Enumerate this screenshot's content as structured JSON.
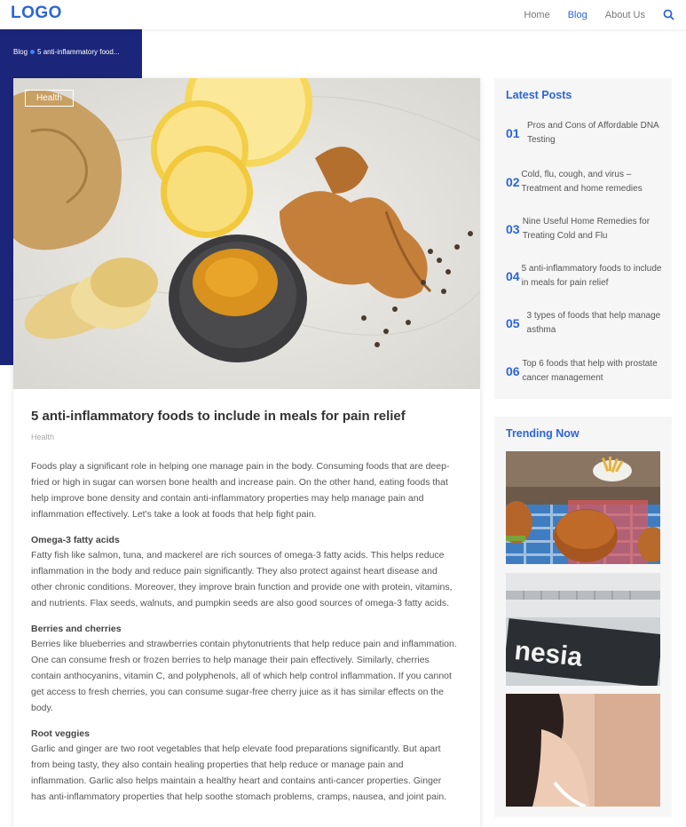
{
  "header": {
    "logo": "LOGO",
    "nav": [
      {
        "label": "Home"
      },
      {
        "label": "Blog"
      },
      {
        "label": "About Us"
      }
    ]
  },
  "breadcrumb": {
    "parent": "Blog",
    "current": "5 anti-inflammatory food..."
  },
  "article": {
    "tag": "Health",
    "title": "5 anti-inflammatory foods to include in meals for pain relief",
    "category": "Health",
    "intro": "Foods play a significant role in helping one manage pain in the body. Consuming foods that are deep-fried or high in sugar can worsen bone health and increase pain. On the other hand, eating foods that help improve bone density and contain anti-inflammatory properties may help manage pain and inflammation effectively. Let's take a look at foods that help fight pain.",
    "sections": [
      {
        "heading": "Omega-3 fatty acids",
        "text": "Fatty fish like salmon, tuna, and mackerel are rich sources of omega-3 fatty acids. This helps reduce inflammation in the body and reduce pain significantly. They also protect against heart disease and other chronic conditions. Moreover, they improve brain function and provide one with protein, vitamins, and nutrients. Flax seeds, walnuts, and pumpkin seeds are also good sources of omega-3 fatty acids."
      },
      {
        "heading": "Berries and cherries",
        "text": "Berries like blueberries and strawberries contain phytonutrients that help reduce pain and inflammation. One can consume fresh or frozen berries to help manage their pain effectively. Similarly, cherries contain anthocyanins, vitamin C, and polyphenols, all of which help control inflammation. If you cannot get access to fresh cherries, you can consume sugar-free cherry juice as it has similar effects on the body."
      },
      {
        "heading": "Root veggies",
        "text": "Garlic and ginger are two root vegetables that help elevate food preparations significantly. But apart from being tasty, they also contain healing properties that help reduce or manage pain and inflammation. Garlic also helps maintain a healthy heart and contains anti-cancer properties. Ginger has anti-inflammatory properties that help soothe stomach problems, cramps, nausea, and joint pain."
      }
    ]
  },
  "sidebar": {
    "latest_title": "Latest Posts",
    "latest": [
      {
        "num": "01",
        "title": "Pros and Cons of Affordable DNA Testing"
      },
      {
        "num": "02",
        "title": "Cold, flu, cough, and virus – Treatment and home remedies"
      },
      {
        "num": "03",
        "title": "Nine Useful Home Remedies for Treating Cold and Flu"
      },
      {
        "num": "04",
        "title": "5 anti-inflammatory foods to include in meals for pain relief"
      },
      {
        "num": "05",
        "title": "3 types of foods that help manage asthma"
      },
      {
        "num": "06",
        "title": "Top 6 foods that help with prostate cancer management"
      }
    ],
    "trending_title": "Trending Now",
    "trending_image_text": "nesia"
  },
  "colors": {
    "accent": "#2b66d9",
    "hero_band": "#1b267a",
    "sidebar_bg": "#f6f6f6"
  }
}
